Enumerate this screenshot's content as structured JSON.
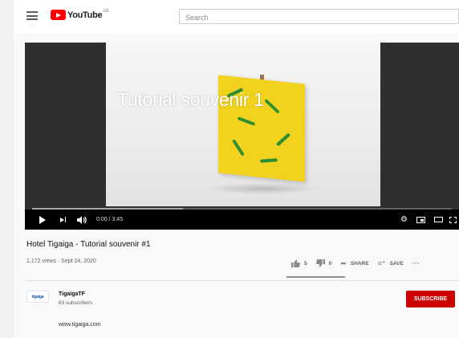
{
  "header": {
    "logo_text": "YouTube",
    "logo_sup": "GB",
    "search_placeholder": "Search"
  },
  "player": {
    "caption_title": "Tutorial souvenir 1",
    "time_display": "0:00 / 3:45",
    "buffered_fraction": 0.36
  },
  "video": {
    "title": "Hotel Tigaiga - Tutorial souvenir #1",
    "meta": "1,172 views · Sept 24, 2020",
    "likes": "5",
    "dislikes": "0",
    "share_label": "SHARE",
    "save_label": "SAVE",
    "more_label": "···",
    "like_ratio": 1.0
  },
  "channel": {
    "avatar_text": "tigaiga",
    "name": "TigaigaTF",
    "subscribers": "63 subscribers",
    "subscribe_label": "SUBSCRIBE",
    "description": "www.tigaiga.com"
  },
  "colors": {
    "brand_red": "#ff0000",
    "subscribe_red": "#cc0000"
  },
  "icons": [
    "menu-icon",
    "youtube-logo-icon",
    "play-icon",
    "next-icon",
    "volume-icon",
    "settings-gear-icon",
    "miniplayer-icon",
    "theater-mode-icon",
    "fullscreen-icon",
    "like-icon",
    "dislike-icon",
    "share-icon",
    "save-icon",
    "more-icon"
  ]
}
